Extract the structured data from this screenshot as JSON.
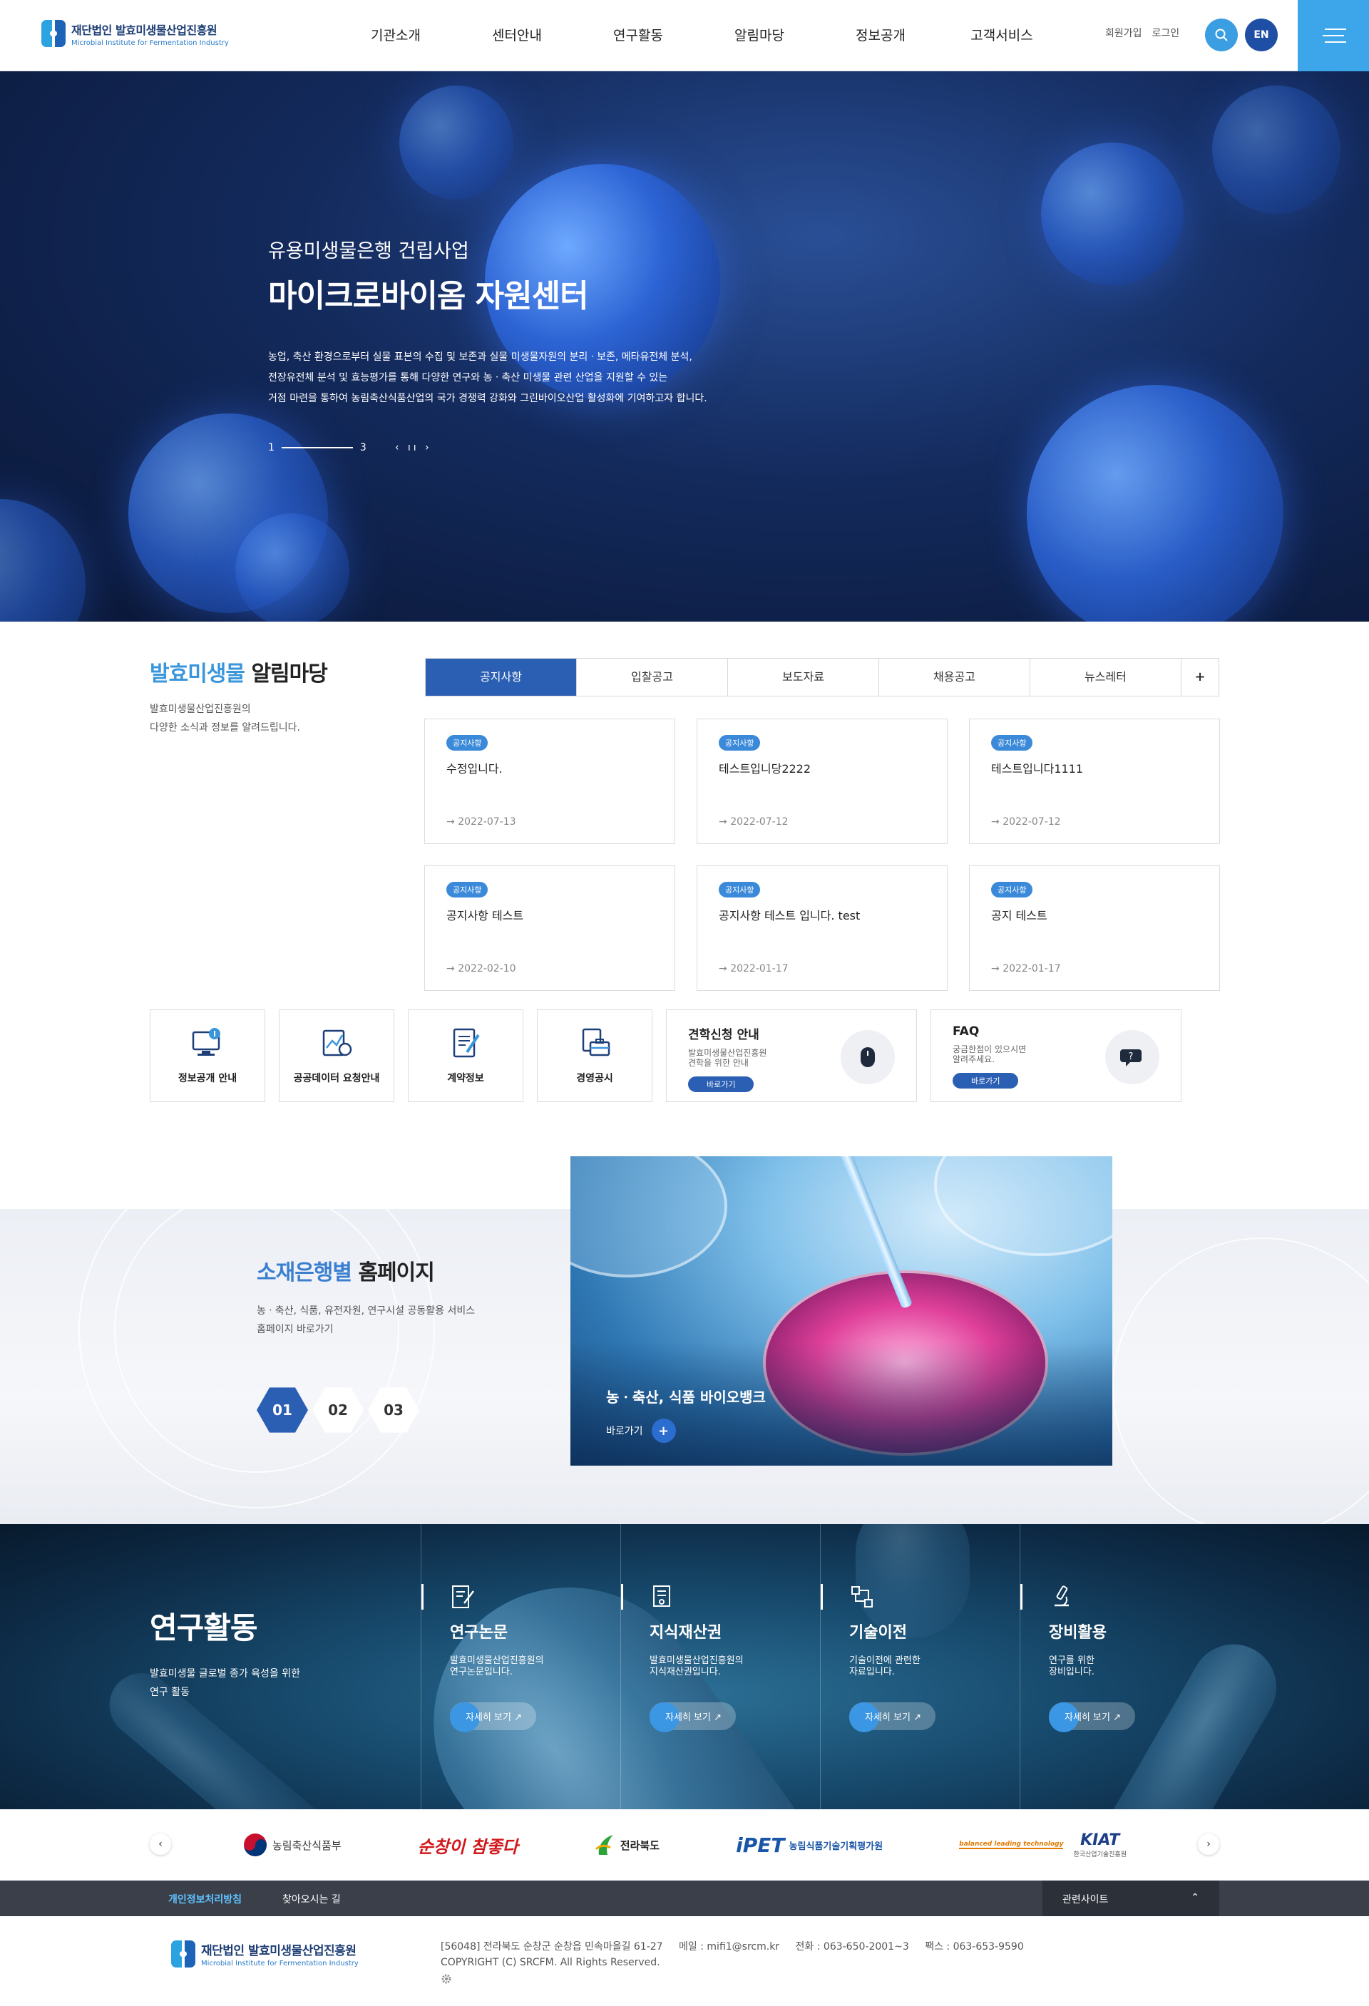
{
  "header": {
    "logo_ko": "재단법인 발효미생물산업진흥원",
    "logo_en": "Microbial Institute for Fermentation Industry",
    "nav": [
      "기관소개",
      "센터안내",
      "연구활동",
      "알림마당",
      "정보공개",
      "고객서비스"
    ],
    "signup": "회원가입",
    "login": "로그인",
    "lang": "EN"
  },
  "hero": {
    "subtitle": "유용미생물은행 건립사업",
    "title": "마이크로바이옴 자원센터",
    "desc": [
      "농업, 축산 환경으로부터 실물 표본의 수집 및 보존과 실물 미생물자원의 분리ㆍ보존, 메타유전체 분석,",
      "전장유전체 분석 및 효능평가를 통해 다양한 연구와 농ㆍ축산 미생물 관련 산업을 지원할 수 있는",
      "거점 마련을 통하여 농림축산식품산업의 국가 경쟁력 강화와 그린바이오산업 활성화에 기여하고자 합니다."
    ],
    "page_current": "1",
    "page_total": "3",
    "controls": "‹ ıı ›"
  },
  "notice": {
    "title_blue": "발효미생물",
    "title_rest": "알림마당",
    "desc": [
      "발효미생물산업진흥원의",
      "다양한 소식과 정보를 알려드립니다."
    ],
    "tabs": [
      "공지사항",
      "입찰공고",
      "보도자료",
      "채용공고",
      "뉴스레터"
    ],
    "tab_more": "+",
    "cards": [
      {
        "badge": "공지사항",
        "title": "수정입니다.",
        "date": "2022-07-13"
      },
      {
        "badge": "공지사항",
        "title": "테스트입니당2222",
        "date": "2022-07-12"
      },
      {
        "badge": "공지사항",
        "title": "테스트입니다1111",
        "date": "2022-07-12"
      },
      {
        "badge": "공지사항",
        "title": "공지사항 테스트",
        "date": "2022-02-10"
      },
      {
        "badge": "공지사항",
        "title": "공지사항 테스트 입니다. test",
        "date": "2022-01-17"
      },
      {
        "badge": "공지사항",
        "title": "공지 테스트",
        "date": "2022-01-17"
      }
    ],
    "date_arrow": "→"
  },
  "quick": {
    "items": [
      "정보공개 안내",
      "공공데이터 요청안내",
      "계약정보",
      "경영공시"
    ],
    "visit": {
      "title": "견학신청 안내",
      "desc": [
        "발효미생물산업진흥원",
        "견학을 위한 안내"
      ],
      "btn": "바로가기"
    },
    "faq": {
      "title": "FAQ",
      "desc": [
        "궁금한점이 있으시면",
        "알려주세요."
      ],
      "btn": "바로가기"
    }
  },
  "bank": {
    "title_blue": "소재은행별",
    "title_rest": "홈페이지",
    "desc": [
      "농ㆍ축산, 식품, 유전자원, 연구시설 공동활용 서비스",
      "홈페이지 바로가기"
    ],
    "pages": [
      "01",
      "02",
      "03"
    ],
    "caption": "농ㆍ축산, 식품 바이오뱅크",
    "more": "바로가기",
    "more_icon": "+"
  },
  "research": {
    "title": "연구활동",
    "desc": [
      "발효미생물 글로벌 종가 육성을 위한",
      "연구 활동"
    ],
    "items": [
      {
        "title": "연구논문",
        "desc": [
          "발효미생물산업진흥원의",
          "연구논문입니다."
        ],
        "more": "자세히 보기 ↗"
      },
      {
        "title": "지식재산권",
        "desc": [
          "발효미생물산업진흥원의",
          "지식재산권입니다."
        ],
        "more": "자세히 보기 ↗"
      },
      {
        "title": "기술이전",
        "desc": [
          "기술이전에 관련한",
          "자료입니다."
        ],
        "more": "자세히 보기 ↗"
      },
      {
        "title": "장비활용",
        "desc": [
          "연구를 위한",
          "장비입니다."
        ],
        "more": "자세히 보기 ↗"
      }
    ]
  },
  "partners": {
    "prev": "‹",
    "next": "›",
    "logos": [
      "농림축산식품부",
      "순창이 참좋다",
      "전라북도",
      "농림식품기술기획평가원",
      "KIAT"
    ],
    "kiat_sub": "한국산업기술진흥원",
    "ipet_mark": "iPET",
    "road_tag": "balanced leading technology"
  },
  "footer": {
    "privacy": "개인정보처리방침",
    "map": "찾아오시는 길",
    "related": "관련사이트",
    "related_icon": "⌃",
    "logo_ko": "재단법인 발효미생물산업진흥원",
    "logo_en": "Microbial Institute for Fermentation Industry",
    "address": "[56048] 전라북도 순창군 순창읍 민속마을길 61-27",
    "email": "메일 : mifi1@srcm.kr",
    "tel": "전화 : 063-650-2001~3",
    "fax": "팩스 : 063-653-9590",
    "copyright": "COPYRIGHT (C) SRCFM. All Rights Reserved."
  },
  "colors": {
    "primary": "#2b5fb4",
    "accent": "#3a96db",
    "menu": "#3da6ea",
    "footer_bar": "#3a3f4a"
  }
}
